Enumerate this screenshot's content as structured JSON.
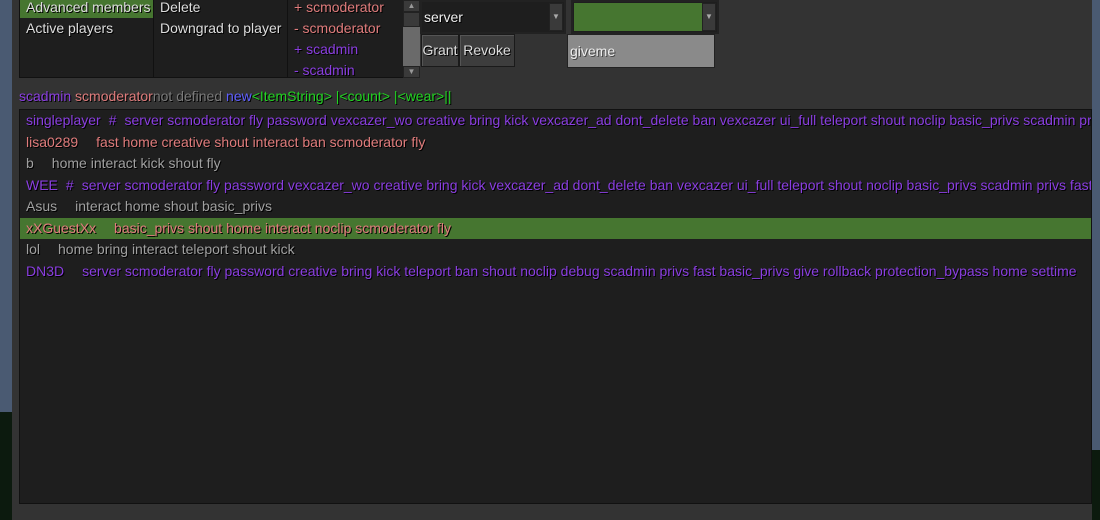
{
  "lists": {
    "categories": {
      "items": [
        {
          "label": "Advanced members",
          "selected": true
        },
        {
          "label": "Active players",
          "selected": false
        }
      ]
    },
    "actions": {
      "items": [
        {
          "label": "Delete"
        },
        {
          "label": "Downgrad to player"
        }
      ]
    },
    "privs": {
      "items": [
        {
          "label": "+ scmoderator",
          "color": "#e07c7c"
        },
        {
          "label": "- scmoderator",
          "color": "#e07c7c"
        },
        {
          "label": "+ scadmin",
          "color": "#8a3ee0"
        },
        {
          "label": "- scadmin",
          "color": "#8a3ee0"
        }
      ],
      "scrollbar": {
        "up_icon": "▲",
        "down_icon": "▼"
      }
    }
  },
  "controls": {
    "priv_dropdown": {
      "value": "server",
      "arrow": "▼"
    },
    "color_dropdown": {
      "value": "",
      "color": "#467630",
      "arrow": "▼"
    },
    "grant_label": "Grant",
    "revoke_label": "Revoke",
    "give_field": {
      "value": "giveme"
    }
  },
  "legend": {
    "admin": "scadmin",
    "moderator": "scmoderator",
    "undefined": "not defined",
    "new": "new",
    "syntax": "<ItemString> |<count> |<wear>||"
  },
  "colors": {
    "admin": "#8a3ee0",
    "moderator": "#e07c7c",
    "undefined": "#a0a0a0",
    "selection": "#467630"
  },
  "players": [
    {
      "name": "singleplayer",
      "marker": "#",
      "privs": "server scmoderator fly password vexcazer_wo creative bring kick vexcazer_ad dont_delete ban vexcazer ui_full teleport shout noclip basic_privs scadmin privs fast",
      "color": "#8a3ee0",
      "selected": false
    },
    {
      "name": "lisa0289",
      "marker": "",
      "privs": "fast home creative shout interact ban scmoderator fly",
      "color": "#e07c7c",
      "selected": false
    },
    {
      "name": "b",
      "marker": "",
      "privs": "home interact kick shout fly",
      "color": "#a0a0a0",
      "selected": false
    },
    {
      "name": "WEE",
      "marker": "#",
      "privs": "server scmoderator fly password vexcazer_wo creative bring kick vexcazer_ad dont_delete ban vexcazer ui_full teleport shout noclip basic_privs scadmin privs fast",
      "color": "#8a3ee0",
      "selected": false
    },
    {
      "name": "Asus",
      "marker": "",
      "privs": "interact home shout basic_privs",
      "color": "#a0a0a0",
      "selected": false
    },
    {
      "name": "xXGuestXx",
      "marker": "",
      "privs": "basic_privs shout home interact noclip scmoderator fly",
      "color": "#e07c7c",
      "selected": true
    },
    {
      "name": "lol",
      "marker": "",
      "privs": "home bring interact teleport shout kick",
      "color": "#a0a0a0",
      "selected": false
    },
    {
      "name": "DN3D",
      "marker": "",
      "privs": "server scmoderator fly password creative bring kick teleport ban shout noclip debug scadmin privs fast basic_privs give rollback protection_bypass home settime",
      "color": "#8a3ee0",
      "selected": false
    }
  ]
}
